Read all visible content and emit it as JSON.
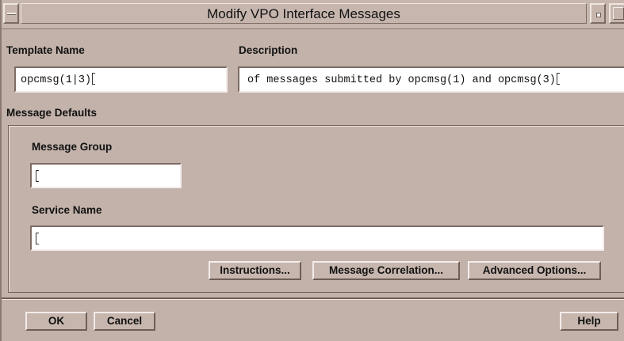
{
  "window": {
    "title": "Modify VPO Interface Messages"
  },
  "template": {
    "name_label": "Template Name",
    "name_value": "opcmsg(1|3)",
    "description_label": "Description",
    "description_value": "of messages submitted by opcmsg(1) and opcmsg(3)"
  },
  "defaults": {
    "section_label": "Message Defaults",
    "message_group_label": "Message Group",
    "message_group_value": "",
    "service_name_label": "Service Name",
    "service_name_value": "",
    "buttons": {
      "instructions": "Instructions...",
      "message_correlation": "Message Correlation...",
      "advanced_options": "Advanced Options..."
    }
  },
  "footer": {
    "ok": "OK",
    "cancel": "Cancel",
    "help": "Help"
  },
  "colors": {
    "window_bg": "#c2b2aa",
    "field_bg": "#ffffff"
  }
}
